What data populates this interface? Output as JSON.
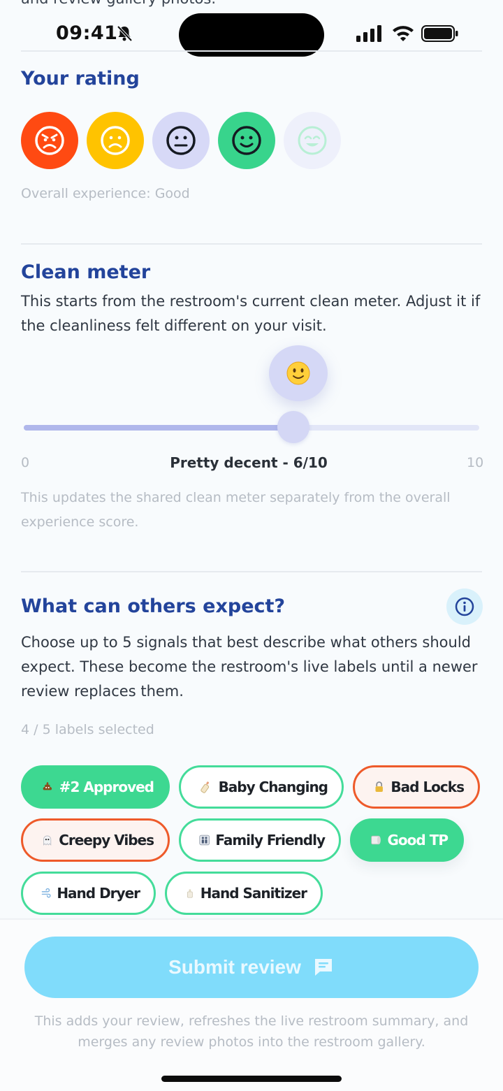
{
  "top_cut_text": "and review gallery photos.",
  "status": {
    "time": "09:41"
  },
  "rating": {
    "title": "Your rating",
    "faces": [
      {
        "name": "very-bad",
        "color": "#ff4a12"
      },
      {
        "name": "bad",
        "color": "#ffc300"
      },
      {
        "name": "okay",
        "color": "#d7d9f7"
      },
      {
        "name": "good",
        "color": "#38d48c"
      },
      {
        "name": "great",
        "color": "#eef0fb"
      }
    ],
    "caption": "Overall experience: Good"
  },
  "clean": {
    "title": "Clean meter",
    "desc": "This starts from the restroom's current clean meter. Adjust it if the cleanliness felt different on your visit.",
    "min_label": "0",
    "max_label": "10",
    "value": 6,
    "value_label": "Pretty decent - 6/10",
    "note": "This updates the shared clean meter separately from the overall experience score."
  },
  "expect": {
    "title": "What can others expect?",
    "desc": "Choose up to 5 signals that best describe what others should expect. These become the restroom's live labels until a newer review replaces them.",
    "count_label": "4 / 5 labels selected",
    "chips": [
      {
        "label": "#2 Approved",
        "icon": "poop-icon",
        "state": "selected"
      },
      {
        "label": "Baby Changing",
        "icon": "baby-bottle-icon",
        "state": "positive"
      },
      {
        "label": "Bad Locks",
        "icon": "lock-icon",
        "state": "negative"
      },
      {
        "label": "Creepy Vibes",
        "icon": "ghost-icon",
        "state": "negative"
      },
      {
        "label": "Family Friendly",
        "icon": "family-icon",
        "state": "positive"
      },
      {
        "label": "Good TP",
        "icon": "toilet-paper-icon",
        "state": "selected"
      },
      {
        "label": "Hand Dryer",
        "icon": "wind-icon",
        "state": "positive"
      },
      {
        "label": "Hand Sanitizer",
        "icon": "lotion-bottle-icon",
        "state": "positive"
      }
    ]
  },
  "submit": {
    "label": "Submit review",
    "footer": "This adds your review, refreshes the live restroom summary, and merges any review photos into the restroom gallery."
  }
}
